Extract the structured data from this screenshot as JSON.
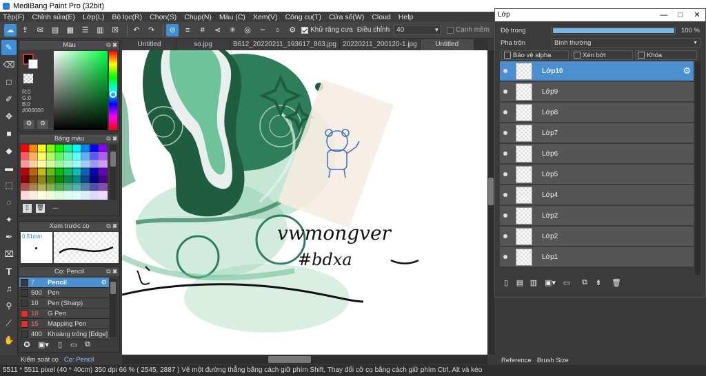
{
  "app": {
    "title": "MediBang Paint Pro (32bit)"
  },
  "menu": [
    "Tệp(F)",
    "Chỉnh sửa(E)",
    "Lớp(L)",
    "Bộ lọc(R)",
    "Chọn(S)",
    "Chụp(N)",
    "Màu (C)",
    "Xem(V)",
    "Công cụ(T)",
    "Cửa số(W)",
    "Cloud",
    "Help"
  ],
  "toolbar": {
    "antialias_label": "Khử răng cưa",
    "adjust_label": "Điều chỉnh",
    "adjust_value": "40",
    "smooth_label": "Cạnh mềm"
  },
  "color_panel": {
    "title": "Màu",
    "r": "R:0",
    "g": "G:0",
    "b": "B:0",
    "hex": "#000000"
  },
  "palette_panel": {
    "title": "Bảng màu",
    "extra": "---"
  },
  "preview_panel": {
    "title": "Xem trước cọ",
    "size": "0.51mm"
  },
  "brush_panel": {
    "title": "Cọ: Pencil",
    "items": [
      {
        "size": "7",
        "name": "Pencil",
        "color": "#3a3a3a"
      },
      {
        "size": "500",
        "name": "Pen",
        "color": "#3a3a3a"
      },
      {
        "size": "10",
        "name": "Pen (Sharp)",
        "color": "#3a3a3a"
      },
      {
        "size": "10",
        "name": "G Pen",
        "color": "#e03030"
      },
      {
        "size": "15",
        "name": "Mapping Pen",
        "color": "#e03030"
      },
      {
        "size": "400",
        "name": "Khoảng trống [Edge]",
        "color": "#3a3a3a"
      }
    ]
  },
  "bottom_tabs": [
    "Kiểm soát cọ",
    "Cọ: Pencil"
  ],
  "doc_tabs": [
    "Untitled",
    "so.jpg",
    "B612_20220211_193617_863.jpg",
    "20220211_200120-1.jpg",
    "Untitled"
  ],
  "status": "5511 * 5511 pixel  (40 * 40cm)  350 dpi  66 %  ( 2545, 2887 )  Vẽ một đường thẳng bằng cách giữ phím Shift, Thay đổi cỡ cọ bằng cách giữ phím Ctrl, Alt và kéo",
  "layer_panel": {
    "title": "Lớp",
    "opacity_label": "Độ trong",
    "opacity_value": "100 %",
    "blend_label": "Pha trộn",
    "blend_value": "Bình thường",
    "protect_alpha": "Bảo vệ alpha",
    "clipping": "Xén bớt",
    "lock": "Khóa",
    "layers": [
      "Lớp10",
      "Lớp9",
      "Lớp8",
      "Lớp7",
      "Lớp6",
      "Lớp5",
      "Lớp4",
      "Lớp2",
      "Lớp2",
      "Lớp1"
    ]
  },
  "right_tabs": [
    "Reference",
    "Brush Size"
  ],
  "canvas_text": {
    "handwriting1": "vwmongver",
    "handwriting2": "#bdxa"
  }
}
